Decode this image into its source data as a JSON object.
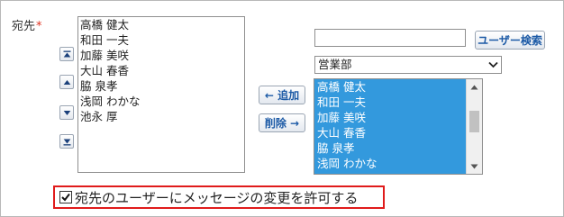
{
  "field": {
    "label": "宛先",
    "required_mark": "*"
  },
  "recipients": [
    "高橋 健太",
    "和田 一夫",
    "加藤 美咲",
    "大山 春香",
    "脇 泉孝",
    "浅岡 わかな",
    "池永 厚"
  ],
  "order_buttons": [
    {
      "icon": "move-top-icon"
    },
    {
      "icon": "move-up-icon"
    },
    {
      "icon": "move-down-icon"
    },
    {
      "icon": "move-bottom-icon"
    }
  ],
  "actions": {
    "add_label": "← 追加",
    "remove_label": "削除 →"
  },
  "search": {
    "value": "",
    "button_label": "ユーザー検索"
  },
  "group_select": {
    "selected": "営業部"
  },
  "candidates": [
    "高橋 健太",
    "和田 一夫",
    "加藤 美咲",
    "大山 春香",
    "脇 泉孝",
    "浅岡 わかな"
  ],
  "permission": {
    "checked": true,
    "label": "宛先のユーザーにメッセージの変更を許可する"
  },
  "colors": {
    "selection": "#3399dd",
    "required": "#e0301e",
    "highlight_border": "#e01b1b",
    "button_text": "#1c5aa6"
  }
}
